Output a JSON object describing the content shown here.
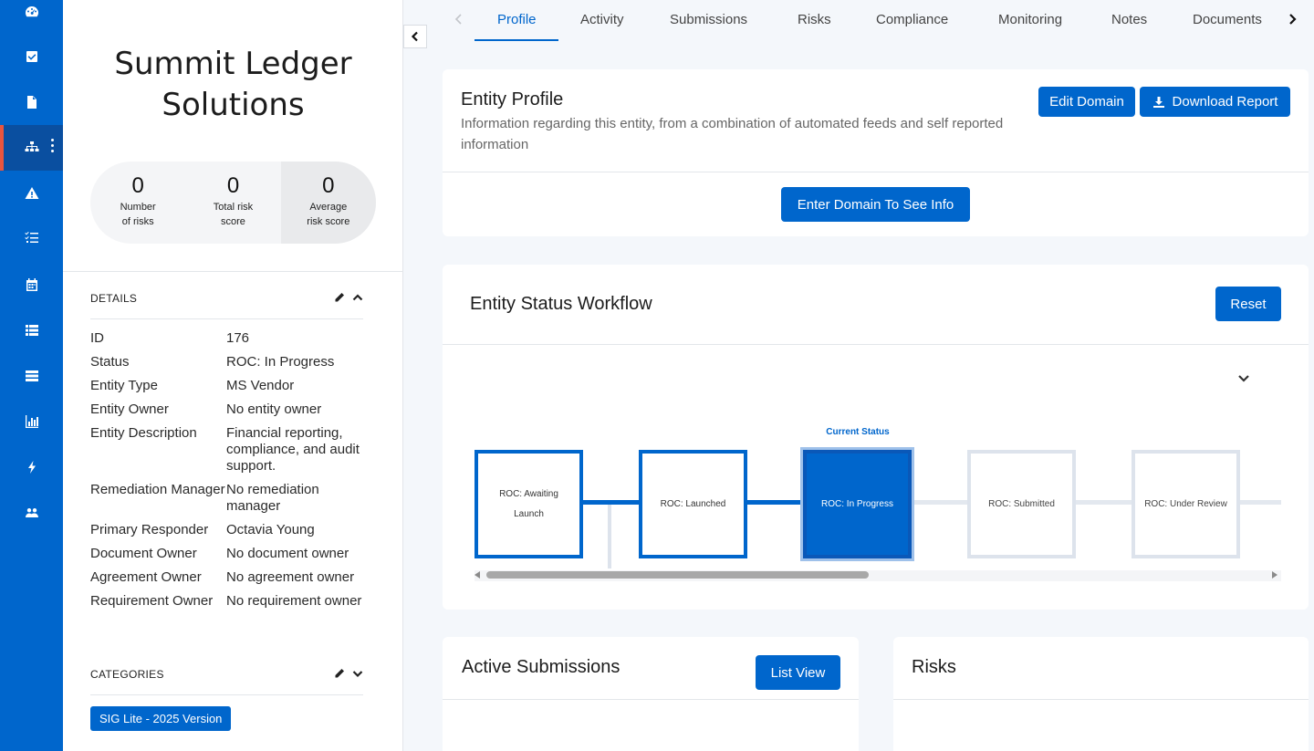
{
  "rail": {
    "items": [
      {
        "icon": "dashboard-icon"
      },
      {
        "icon": "check-square-icon"
      },
      {
        "icon": "document-icon"
      },
      {
        "icon": "sitemap-icon",
        "active": true
      },
      {
        "icon": "warning-icon"
      },
      {
        "icon": "tasks-icon"
      },
      {
        "icon": "calendar-icon"
      },
      {
        "icon": "list-icon"
      },
      {
        "icon": "server-icon"
      },
      {
        "icon": "bar-chart-icon"
      },
      {
        "icon": "bolt-icon"
      },
      {
        "icon": "users-icon"
      }
    ],
    "accent_color": "#e8553f"
  },
  "entity": {
    "title": "Summit Ledger Solutions",
    "stats": [
      {
        "value": "0",
        "label_line1": "Number",
        "label_line2": "of risks"
      },
      {
        "value": "0",
        "label_line1": "Total risk",
        "label_line2": "score"
      },
      {
        "value": "0",
        "label_line1": "Average",
        "label_line2": "risk score"
      }
    ]
  },
  "details": {
    "heading": "DETAILS",
    "rows": [
      {
        "key": "ID",
        "value": "176"
      },
      {
        "key": "Status",
        "value": "ROC: In Progress"
      },
      {
        "key": "Entity Type",
        "value": "MS Vendor"
      },
      {
        "key": "Entity Owner",
        "value": "No entity owner"
      },
      {
        "key": "Entity Description",
        "value": "Financial reporting, compliance, and audit support."
      },
      {
        "key": "Remediation Manager",
        "value": "No remediation manager"
      },
      {
        "key": "Primary Responder",
        "value": "Octavia Young"
      },
      {
        "key": "Document Owner",
        "value": "No document owner"
      },
      {
        "key": "Agreement Owner",
        "value": "No agreement owner"
      },
      {
        "key": "Requirement Owner",
        "value": "No requirement owner"
      }
    ]
  },
  "categories": {
    "heading": "CATEGORIES",
    "items": [
      "SIG Lite - 2025 Version"
    ]
  },
  "tabs": [
    "Profile",
    "Activity",
    "Submissions",
    "Risks",
    "Compliance",
    "Monitoring",
    "Notes",
    "Documents"
  ],
  "active_tab": "Profile",
  "profile_card": {
    "title": "Entity Profile",
    "subtitle": "Information regarding this entity, from a combination of automated feeds and self reported information",
    "edit_domain_label": "Edit Domain",
    "download_report_label": "Download Report",
    "enter_domain_label": "Enter Domain To See Info"
  },
  "workflow": {
    "title": "Entity Status Workflow",
    "reset_label": "Reset",
    "current_status_label": "Current Status",
    "steps": [
      {
        "label": "ROC: Awaiting Launch",
        "state": "done"
      },
      {
        "label": "ROC: Launched",
        "state": "done"
      },
      {
        "label": "ROC: In Progress",
        "state": "current"
      },
      {
        "label": "ROC: Submitted",
        "state": "future"
      },
      {
        "label": "ROC: Under Review",
        "state": "future"
      }
    ],
    "primary_color": "#0066cc"
  },
  "submissions_card": {
    "title": "Active Submissions",
    "list_view_label": "List View"
  },
  "risks_card": {
    "title": "Risks"
  }
}
